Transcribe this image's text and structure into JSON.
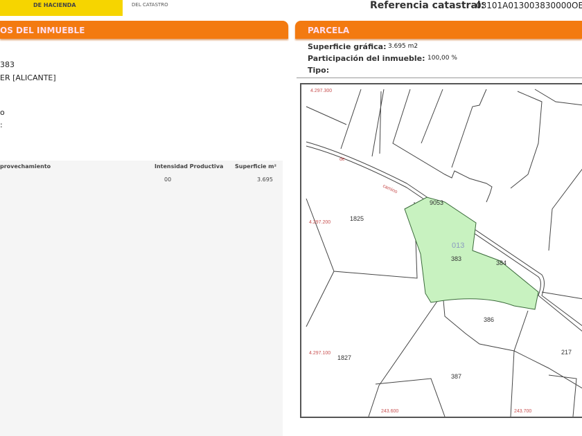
{
  "header": {
    "ministry": "DE HACIENDA",
    "catastro": "DEL CATASTRO",
    "ref_label": "Referencia catastral:",
    "ref_value": "03101A013003830000OE"
  },
  "inmueble": {
    "title": "OS DEL INMUEBLE",
    "line1": "383",
    "line2": "ER [ALICANTE]",
    "line3": "o",
    "line4": ":",
    "table": {
      "headers": [
        "provechamiento",
        "Intensidad Productiva",
        "Superficie m²"
      ],
      "rows": [
        [
          "",
          "00",
          "3.695"
        ]
      ]
    }
  },
  "parcela": {
    "title": "PARCELA",
    "superficie_label": "Superficie gráfica:",
    "superficie_value": "3.695 m2",
    "participacion_label": "Participación del inmueble:",
    "participacion_value": "100,00 %",
    "tipo_label": "Tipo:"
  },
  "map": {
    "polygon": "013",
    "parcels": [
      "9053",
      "1825",
      "383",
      "384",
      "386",
      "1827",
      "387",
      "217"
    ],
    "coords": [
      "4.297.300",
      "4.297.200",
      "4.297.100",
      "243.600",
      "243.700"
    ],
    "road_labels": [
      "de",
      "camino"
    ],
    "highlight_color": "#c8f2c0"
  }
}
